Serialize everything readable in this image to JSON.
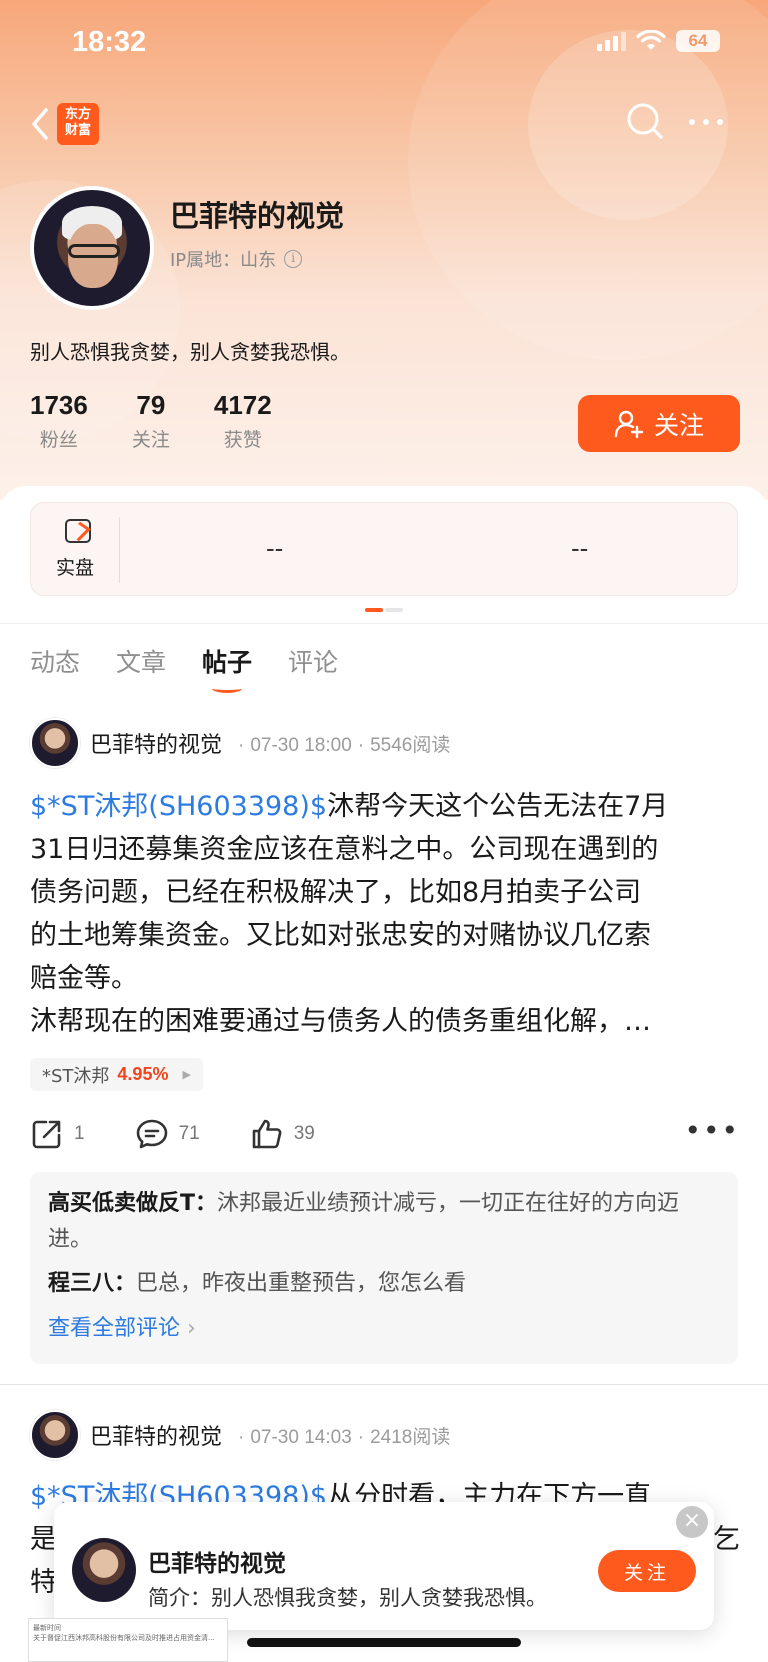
{
  "status": {
    "time": "18:32",
    "battery": "64"
  },
  "nav": {
    "brand_line1": "东方",
    "brand_line2": "财富"
  },
  "profile": {
    "name": "巴菲特的视觉",
    "ip": "IP属地：山东",
    "bio": "别人恐惧我贪婪，别人贪婪我恐惧。",
    "stats": [
      {
        "num": "1736",
        "label": "粉丝"
      },
      {
        "num": "79",
        "label": "关注"
      },
      {
        "num": "4172",
        "label": "获赞"
      }
    ],
    "follow_label": "关注"
  },
  "real_account": {
    "label": "实盘",
    "value1": "--",
    "value2": "--"
  },
  "tabs": [
    {
      "label": "动态"
    },
    {
      "label": "文章"
    },
    {
      "label": "帖子",
      "active": true
    },
    {
      "label": "评论"
    }
  ],
  "posts": [
    {
      "author": "巴菲特的视觉",
      "time": "07-30 18:00",
      "reads": "5546阅读",
      "tag": "$*ST沐邦(SH603398)$",
      "line1": "沐帮今天这个公告无法在7月",
      "line2": "31日归还募集资金应该在意料之中。公司现在遇到的",
      "line3": "债务问题，已经在积极解决了，比如8月拍卖子公司",
      "line4": "的土地筹集资金。又比如对张忠安的对赌协议几亿索",
      "line5": "赔金等。",
      "line6": "沐帮现在的困难要通过与债务人的债务重组化解，…",
      "stock": {
        "name": "*ST沐邦",
        "pct": "4.95%"
      },
      "shares": "1",
      "comments_count": "71",
      "likes": "39",
      "comments": [
        {
          "user": "高买低卖做反T：",
          "text": "沐邦最近业绩预计减亏，一切正在往好的方向迈进。"
        },
        {
          "user": "程三八：",
          "text": "巴总，昨夜出重整预告，您怎么看"
        }
      ],
      "view_all": "查看全部评论"
    },
    {
      "author": "巴菲特的视觉",
      "time": "07-30 14:03",
      "reads": "2418阅读",
      "tag": "$*ST沐邦(SH603398)$",
      "line1": "从分时看，主力在下方一直",
      "line2": "是",
      "line2_end": "乞",
      "line3": "特"
    }
  ],
  "popup": {
    "name": "巴菲特的视觉",
    "bio": "简介：别人恐惧我贪婪，别人贪婪我恐惧。",
    "follow": "关注",
    "close": "×"
  },
  "thumb": {
    "line1": "最新时间",
    "line2": "关于督促江西沐邦高科股份有限公司及时推进占用资金清..."
  },
  "colors": {
    "accent": "#ff5a1e",
    "link": "#2d7be0",
    "up": "#f0461e"
  }
}
